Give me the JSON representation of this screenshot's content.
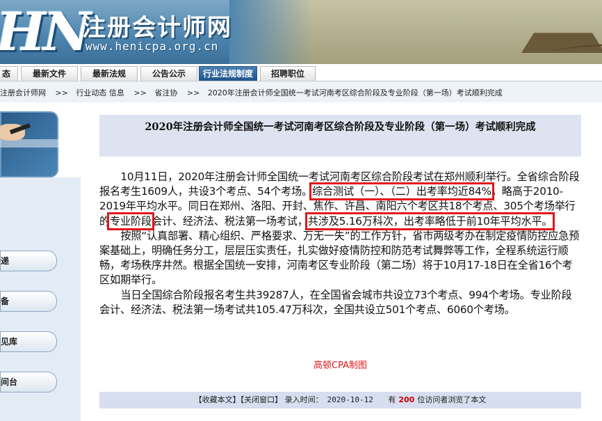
{
  "site": {
    "logo_text": "HN",
    "name": "注册会计师网",
    "url": "www.henicpa.org.cn"
  },
  "nav": {
    "tabs": [
      "态",
      "最新文件",
      "最新法规",
      "公告公示",
      "行业法规制度",
      "招聘职位"
    ],
    "active_index": 4
  },
  "breadcrumb": [
    "注册会计师网",
    ">>",
    "行业动态 信息",
    ">>",
    "省注协",
    ">>",
    "2020年注册会计师全国统一考试河南考区综合阶段及专业阶段（第一场）考试顺利完成"
  ],
  "sidebar": {
    "buttons": [
      "递",
      "备",
      "见库",
      "间台"
    ]
  },
  "article": {
    "title": "2020年注册会计师全国统一考试河南考区综合阶段及专业阶段（第一场）考试顺利完成",
    "p1_a": "10月11日，2020年注册会计师全国统一考试河南考区综合阶段考试在郑州顺利举行。全省综合阶段报名考生1609人，共设3个考点、54个考场。",
    "p1_hl1": "综合测试（一）、（二）出考率均近84%",
    "p1_b": "，略高于2010-2019年平均水平。同日在郑州、洛阳、开封、焦作、许昌、南阳六个考区共18个考点、305个考场举行的",
    "p1_hl2": "专业阶段",
    "p1_c": "会计、经济法、税法第一场考试，",
    "p1_hl3": "共涉及5.16万科次，出考率略低于前10年平均水平。",
    "p2": "按照“认真部署、精心组织、严格要求、万无一失”的工作方针，省市两级考办在制定疫情防控应急预案基础上，明确任务分工，层层压实责任，扎实做好疫情防控和防范考试舞弊等工作，全程系统运行顺畅，考场秩序井然。根据全国统一安排，河南考区专业阶段（第二场）将于10月17-18日在全省16个考区如期举行。",
    "p3": "当日全国综合阶段报名考生共39287人，在全国省会城市共设立73个考点、994个考场。专业阶段会计、经济法、税法第一场考试共105.47万科次，全国共设立501个考点、6060个考场。",
    "watermark": "高顿CPA制图"
  },
  "footer": {
    "bookmark": "【收藏本文】",
    "close": "【关闭窗口】",
    "time_label": "录入时间：",
    "date": "2020-10-12",
    "has": "有",
    "visitors": "200",
    "visitors_suffix": "位访问者浏览了本文"
  },
  "colors": {
    "highlight_box": "#e0161b",
    "title_bg": "#dde3f1",
    "nav_active": "#1e558c",
    "footer_bg": "#d6deef"
  }
}
